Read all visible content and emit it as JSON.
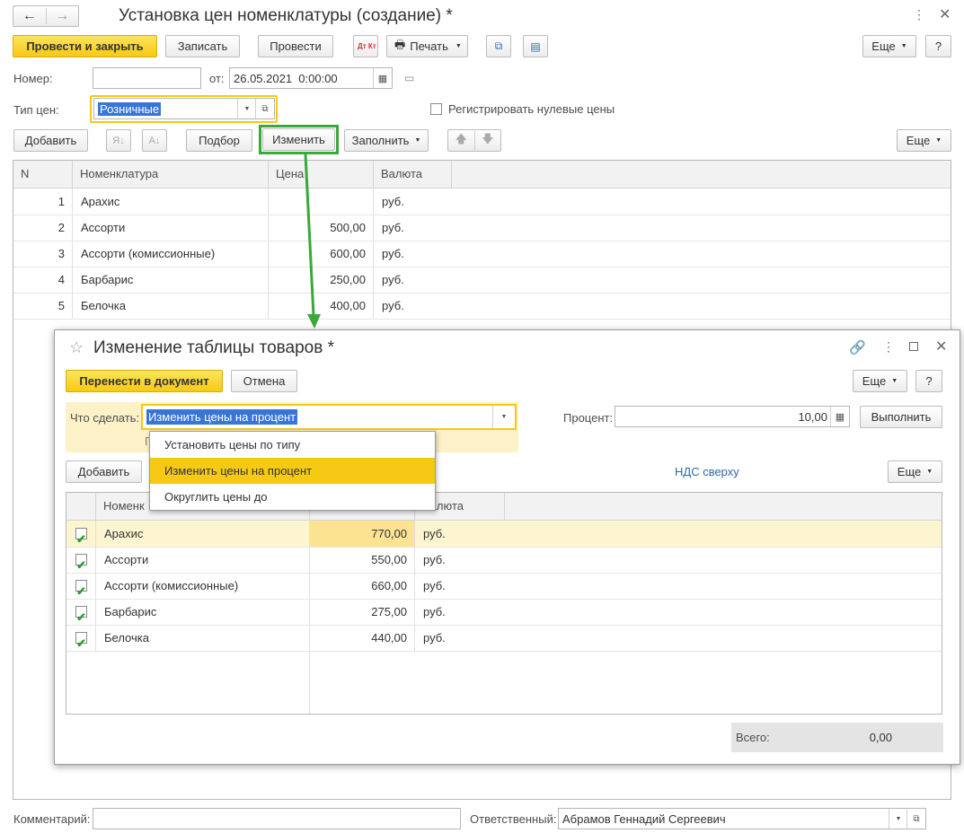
{
  "window": {
    "title": "Установка цен номенклатуры (создание) *",
    "back": "←",
    "forward": "→"
  },
  "toolbar": {
    "post_close": "Провести и закрыть",
    "save": "Записать",
    "post": "Провести",
    "dtkt": "Дт Кт",
    "print": "Печать",
    "more": "Еще",
    "help": "?"
  },
  "header": {
    "number_label": "Номер:",
    "number_value": "",
    "date_label": "от:",
    "date_value": "26.05.2021  0:00:00",
    "price_type_label": "Тип цен:",
    "price_type_value": "Розничные",
    "zero_prices_label": "Регистрировать нулевые цены",
    "zero_prices_checked": false
  },
  "tabletoolbar": {
    "add": "Добавить",
    "select": "Подбор",
    "change": "Изменить",
    "fill": "Заполнить",
    "more": "Еще"
  },
  "table": {
    "columns": [
      "N",
      "Номенклатура",
      "Цена",
      "Валюта"
    ],
    "rows": [
      {
        "n": "1",
        "name": "Арахис",
        "price": "",
        "currency": "руб."
      },
      {
        "n": "2",
        "name": "Ассорти",
        "price": "500,00",
        "currency": "руб."
      },
      {
        "n": "3",
        "name": "Ассорти (комиссионные)",
        "price": "600,00",
        "currency": "руб."
      },
      {
        "n": "4",
        "name": "Барбарис",
        "price": "250,00",
        "currency": "руб."
      },
      {
        "n": "5",
        "name": "Белочка",
        "price": "400,00",
        "currency": "руб."
      }
    ]
  },
  "footer": {
    "comment_label": "Комментарий:",
    "comment_value": "",
    "responsible_label": "Ответственный:",
    "responsible_value": "Абрамов Геннадий Сергеевич"
  },
  "dialog": {
    "title": "Изменение таблицы товаров *",
    "transfer": "Перенести в документ",
    "cancel": "Отмена",
    "more": "Еще",
    "help": "?",
    "action_label": "Что сделать:",
    "action_value": "Изменить цены на процент",
    "percent_label": "Процент:",
    "percent_value": "10,00",
    "execute": "Выполнить",
    "hint_fragment": "Г",
    "dropdown_options": [
      "Установить цены по типу",
      "Изменить цены на процент",
      "Округлить цены до"
    ],
    "dropdown_selected": "Изменить цены на процент",
    "add": "Добавить",
    "vat_link": "НДС сверху",
    "more2": "Еще",
    "columns": [
      "Номенк",
      "Валюта"
    ],
    "rows": [
      {
        "checked": true,
        "name": "Арахис",
        "price": "770,00",
        "currency": "руб."
      },
      {
        "checked": true,
        "name": "Ассорти",
        "price": "550,00",
        "currency": "руб."
      },
      {
        "checked": true,
        "name": "Ассорти (комиссионные)",
        "price": "660,00",
        "currency": "руб."
      },
      {
        "checked": true,
        "name": "Барбарис",
        "price": "275,00",
        "currency": "руб."
      },
      {
        "checked": true,
        "name": "Белочка",
        "price": "440,00",
        "currency": "руб."
      }
    ],
    "total_label": "Всего:",
    "total_value": "0,00"
  },
  "colors": {
    "accent_yellow": "#f6c914",
    "highlight_green": "#3aa83a",
    "selected_row": "#fdf5d0",
    "link": "#2c6aa8"
  }
}
